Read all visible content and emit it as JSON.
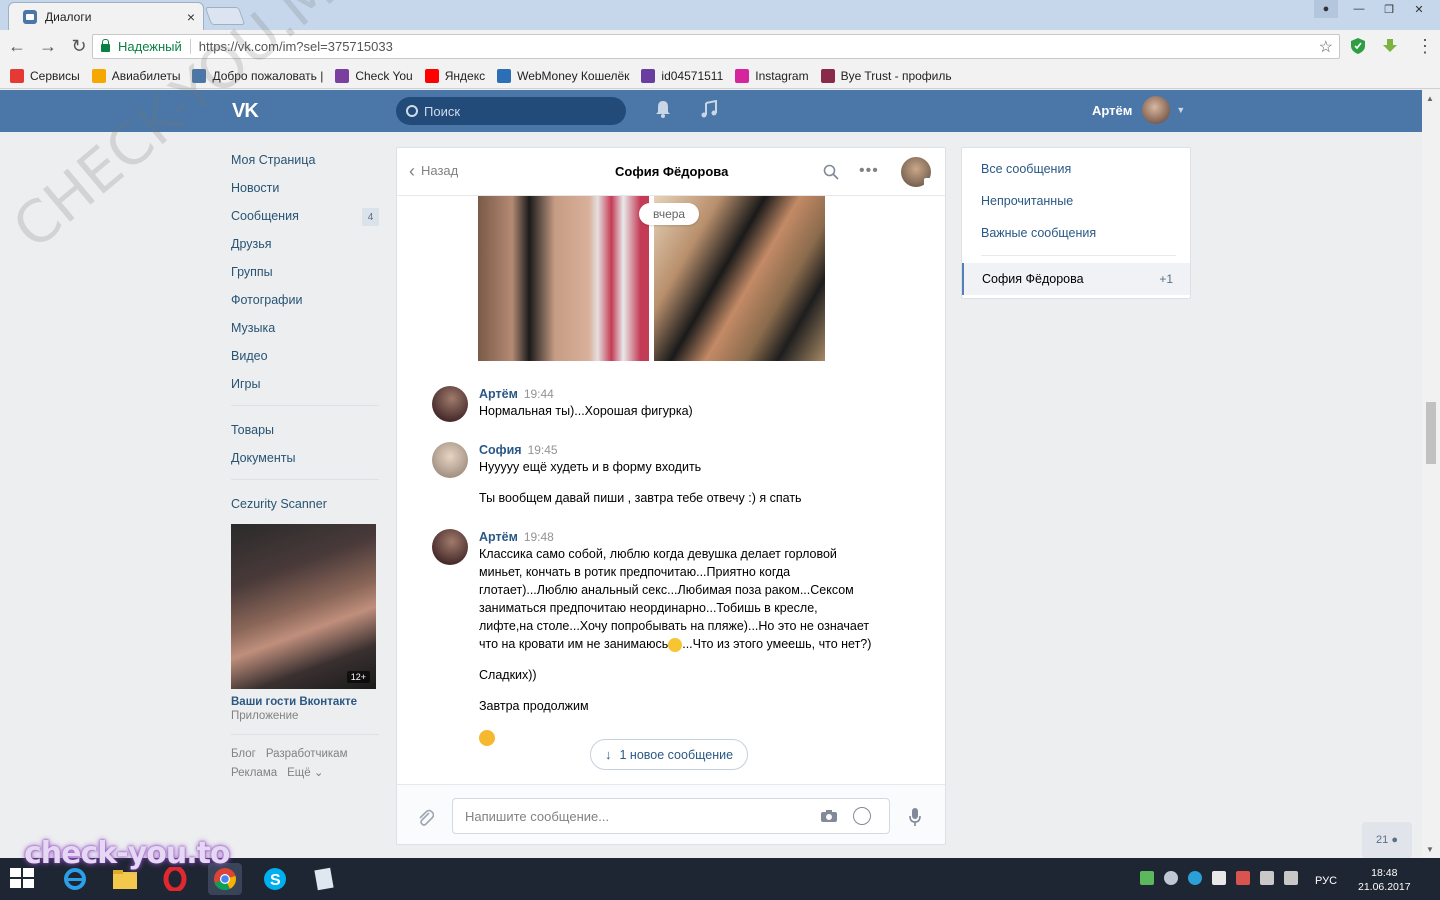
{
  "browser": {
    "tab_title": "Диалоги",
    "tab_close": "×",
    "security_label": "Надежный",
    "url": "https://vk.com/im?sel=375715033",
    "bookmarks": [
      {
        "label": "Сервисы",
        "icon": "apps-icon",
        "color": "#e53935"
      },
      {
        "label": "Авиабилеты",
        "icon": "plane-icon",
        "color": "#f6a800"
      },
      {
        "label": "Добро пожаловать |",
        "icon": "vk-icon",
        "color": "#4a76a8"
      },
      {
        "label": "Check You",
        "icon": "checkyou-icon",
        "color": "#7b3fa0"
      },
      {
        "label": "Яндекс",
        "icon": "yandex-icon",
        "color": "#ff0000"
      },
      {
        "label": "WebMoney Кошелёк",
        "icon": "webmoney-icon",
        "color": "#2d6fb6"
      },
      {
        "label": "id04571511",
        "icon": "s-icon",
        "color": "#6a3ea1"
      },
      {
        "label": "Instagram",
        "icon": "instagram-icon",
        "color": "#d6249f"
      },
      {
        "label": "Bye Trust - профиль",
        "icon": "byetrust-icon",
        "color": "#8a2a4a"
      }
    ]
  },
  "vk": {
    "logo": "VK",
    "search_placeholder": "Поиск",
    "user_name": "Артём",
    "accent": "#4a76a8"
  },
  "left_menu": {
    "items": [
      {
        "label": "Моя Страница",
        "icon": "home-icon"
      },
      {
        "label": "Новости",
        "icon": "news-icon"
      },
      {
        "label": "Сообщения",
        "icon": "messages-icon",
        "count": "4"
      },
      {
        "label": "Друзья",
        "icon": "friends-icon"
      },
      {
        "label": "Группы",
        "icon": "groups-icon"
      },
      {
        "label": "Фотографии",
        "icon": "camera-icon"
      },
      {
        "label": "Музыка",
        "icon": "music-icon"
      },
      {
        "label": "Видео",
        "icon": "video-icon"
      },
      {
        "label": "Игры",
        "icon": "gamepad-icon"
      }
    ],
    "items2": [
      {
        "label": "Товары",
        "icon": "bag-icon"
      },
      {
        "label": "Документы",
        "icon": "document-icon"
      }
    ],
    "items3": [
      {
        "label": "Cezurity Scanner",
        "icon": "apps-grid-icon"
      }
    ],
    "ad": {
      "age_badge": "12+",
      "title": "Ваши гости Вконтакте",
      "subtitle": "Приложение"
    },
    "footer": [
      "Блог",
      "Разработчикам",
      "Реклама",
      "Ещё ⌄"
    ]
  },
  "chat": {
    "back_label": "Назад",
    "title": "София Фёдорова",
    "date_pill": "вчера",
    "messages": [
      {
        "author": "Артём",
        "time": "19:44",
        "lines": [
          "Нормальная ты)...Хорошая фигурка)"
        ]
      },
      {
        "author": "София",
        "time": "19:45",
        "lines": [
          "Нууууу ещё худеть и в форму входить",
          "Ты вообщем давай пиши , завтра тебе отвечу :) я спать"
        ]
      },
      {
        "author": "Артём",
        "time": "19:48",
        "lines": [
          "Классика само собой, люблю когда девушка делает горловой миньет, кончать в ротик предпочитаю...Приятно когда глотает)...Люблю анальный секс...Любимая поза раком...Сексом заниматься предпочитаю неординарно...Тобишь в кресле, лифте,на столе...Хочу попробывать на пляже)...Но это не означает что на кровати им не занимаюсь",
          "...Что из этого умеешь, что нет?)",
          "Сладких))",
          "Завтра продолжим"
        ]
      }
    ],
    "new_message_label": "1 новое сообщение",
    "composer_placeholder": "Напишите сообщение..."
  },
  "right_panel": {
    "items": [
      "Все сообщения",
      "Непрочитанные",
      "Важные сообщения"
    ],
    "active_dialog": "София Фёдорова",
    "active_badge": "+1"
  },
  "online_count": "21",
  "taskbar": {
    "lang": "РУС",
    "time": "18:48",
    "date": "21.06.2017",
    "watermark": "check-you.to"
  },
  "overlay_watermark": "CHECK-YOU.ME"
}
